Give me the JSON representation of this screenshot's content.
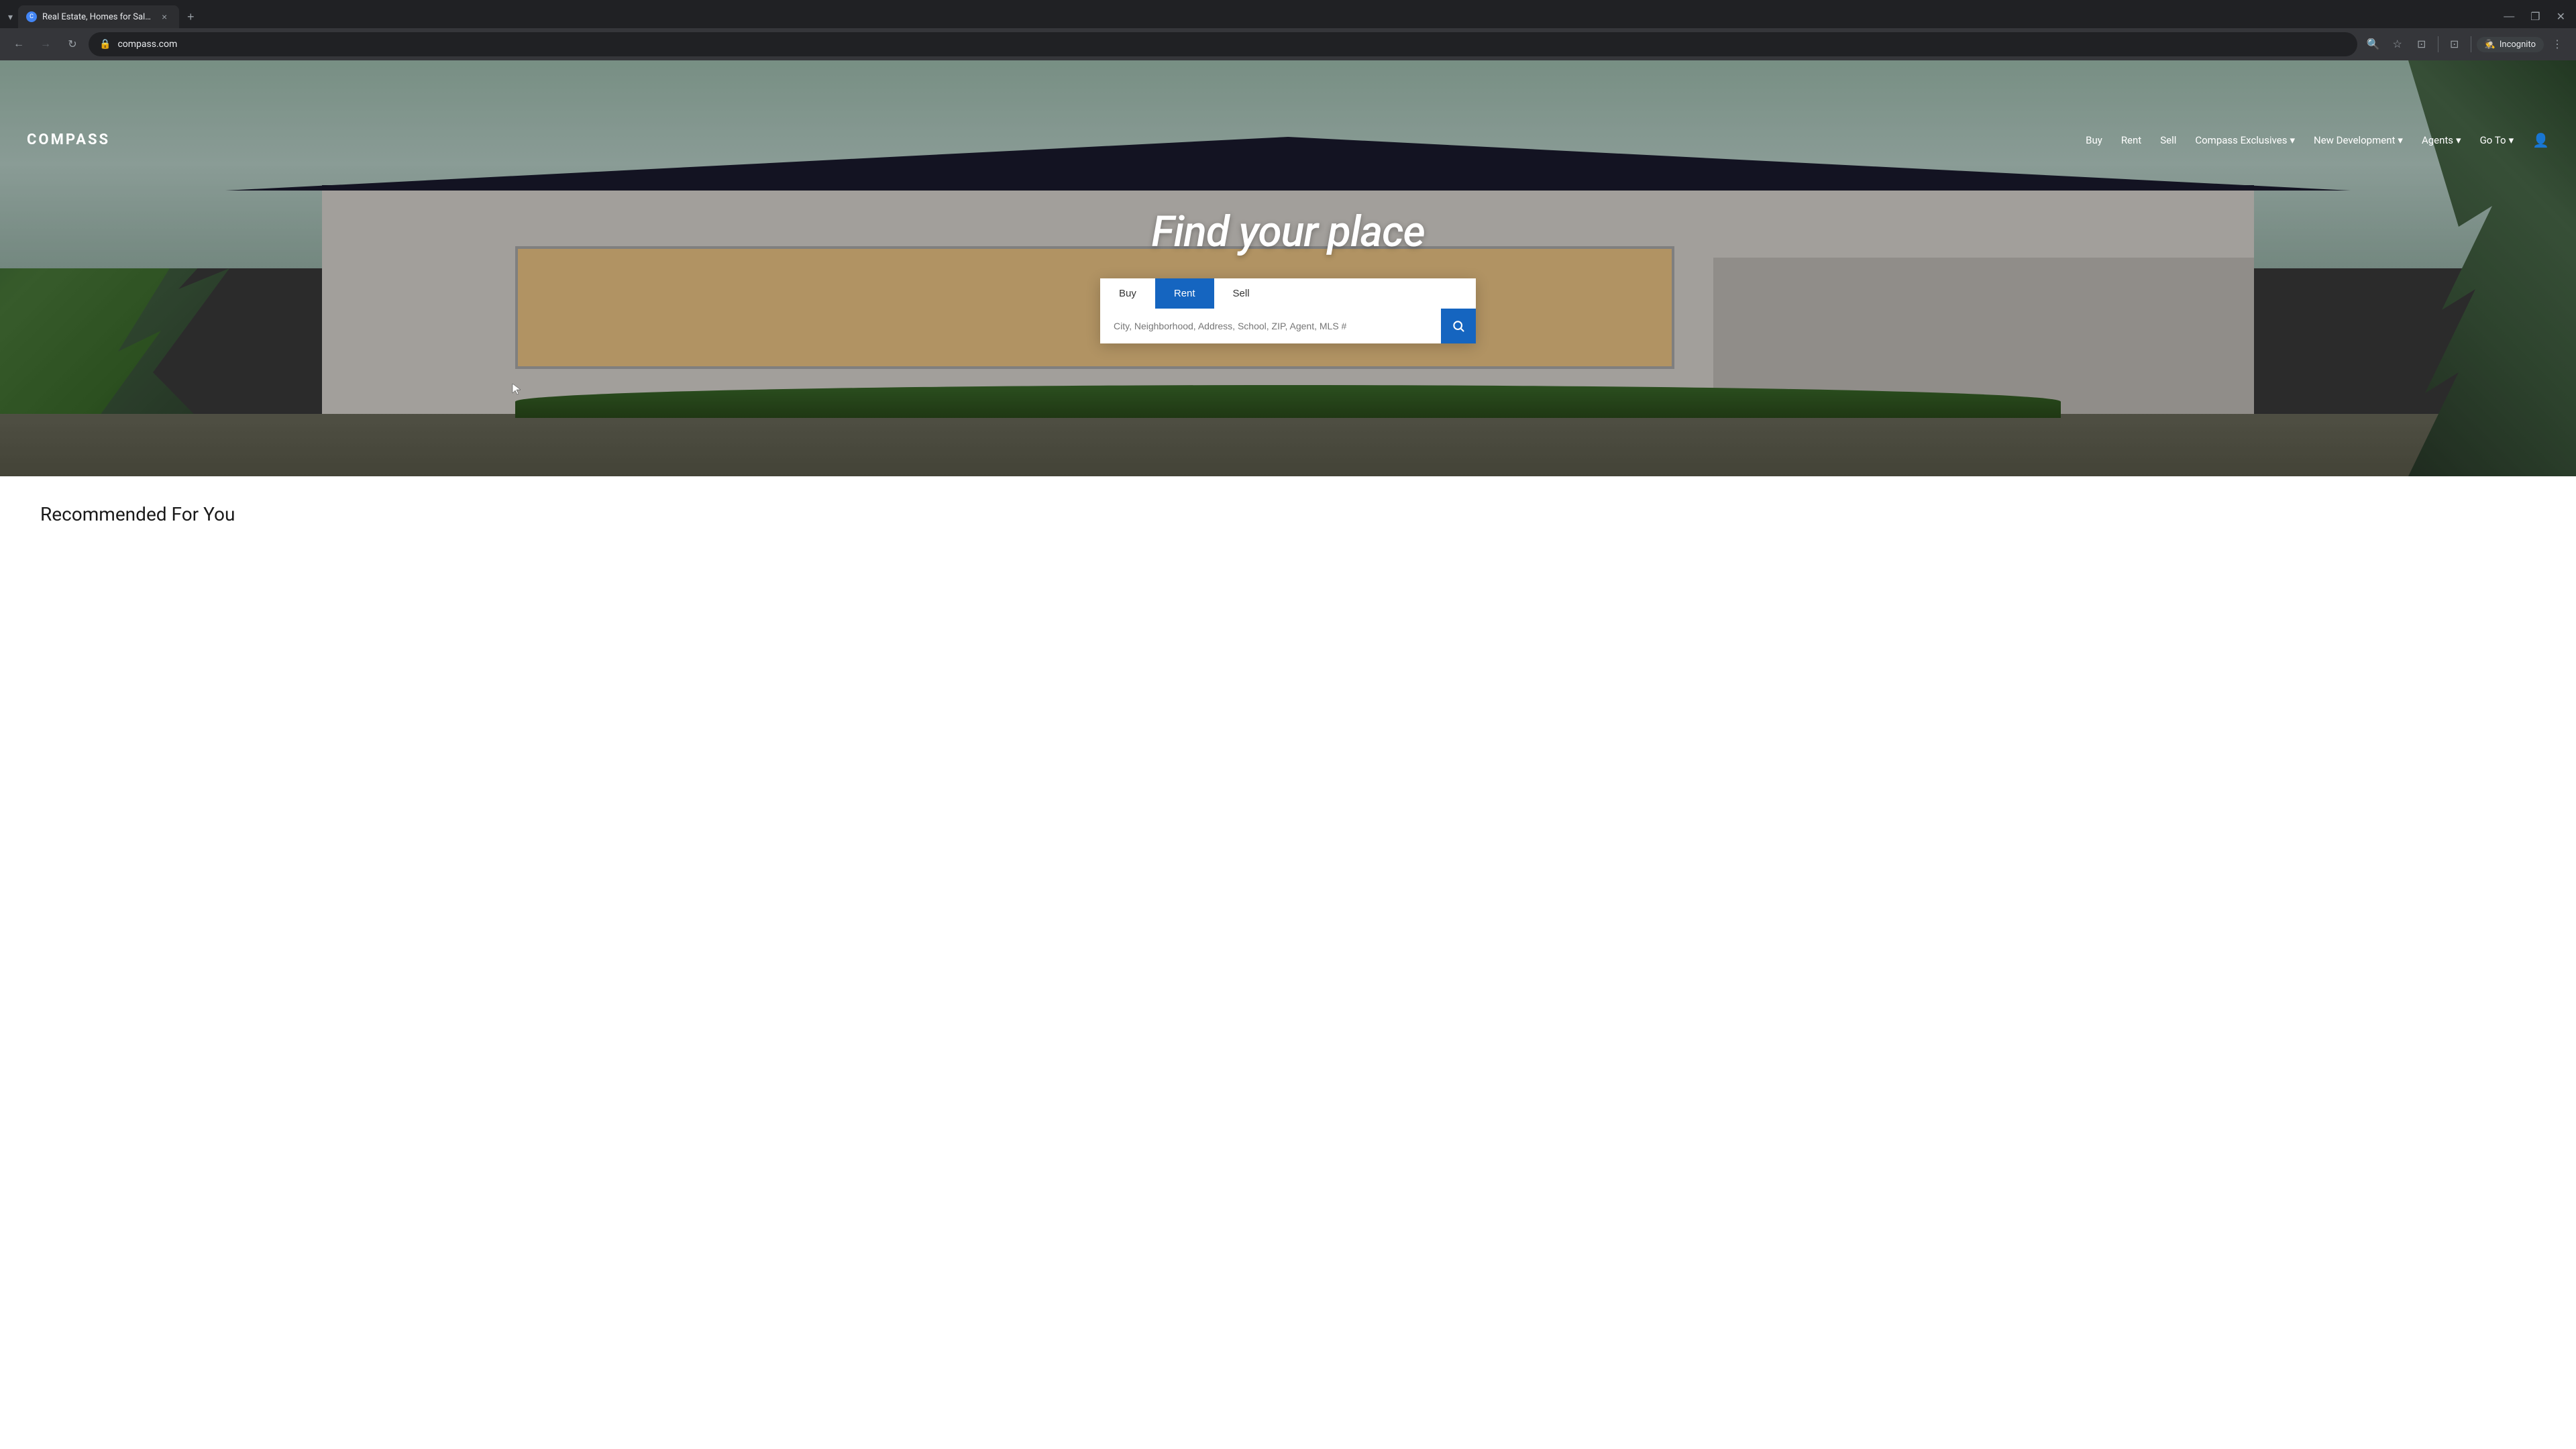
{
  "browser": {
    "tab": {
      "favicon": "C",
      "title": "Real Estate, Homes for Sale & ...",
      "close_label": "×"
    },
    "new_tab_label": "+",
    "window_controls": {
      "minimize": "—",
      "maximize": "❐",
      "close": "✕"
    },
    "toolbar": {
      "back_btn": "←",
      "forward_btn": "→",
      "reload_btn": "↻",
      "url": "compass.com",
      "search_icon": "🔍",
      "bookmark_icon": "☆",
      "tab_manager_icon": "⊡",
      "cast_icon": "⊡",
      "separator": "|",
      "incognito_icon": "🕵",
      "incognito_label": "Incognito",
      "more_icon": "⋮"
    }
  },
  "nav": {
    "logo": "COMPASS",
    "links": [
      {
        "label": "Buy",
        "has_dropdown": false
      },
      {
        "label": "Rent",
        "has_dropdown": false
      },
      {
        "label": "Sell",
        "has_dropdown": false
      },
      {
        "label": "Compass Exclusives",
        "has_dropdown": true
      },
      {
        "label": "New Development",
        "has_dropdown": true
      },
      {
        "label": "Agents",
        "has_dropdown": true
      },
      {
        "label": "Go To",
        "has_dropdown": true
      }
    ]
  },
  "hero": {
    "title": "Find your place",
    "search": {
      "tabs": [
        {
          "label": "Buy",
          "active": false
        },
        {
          "label": "Rent",
          "active": true
        },
        {
          "label": "Sell",
          "active": false
        }
      ],
      "placeholder": "City, Neighborhood, Address, School, ZIP, Agent, MLS #",
      "button_icon": "🔍"
    }
  },
  "recommended": {
    "title": "Recommended For You"
  },
  "colors": {
    "nav_link": "#ffffff",
    "logo": "#ffffff",
    "hero_title": "#ffffff",
    "search_active_tab_bg": "#1565c0",
    "search_active_tab_text": "#ffffff",
    "search_btn_bg": "#1565c0",
    "search_btn_text": "#ffffff",
    "browser_bg": "#202124",
    "browser_tab_bar": "#35363a"
  }
}
